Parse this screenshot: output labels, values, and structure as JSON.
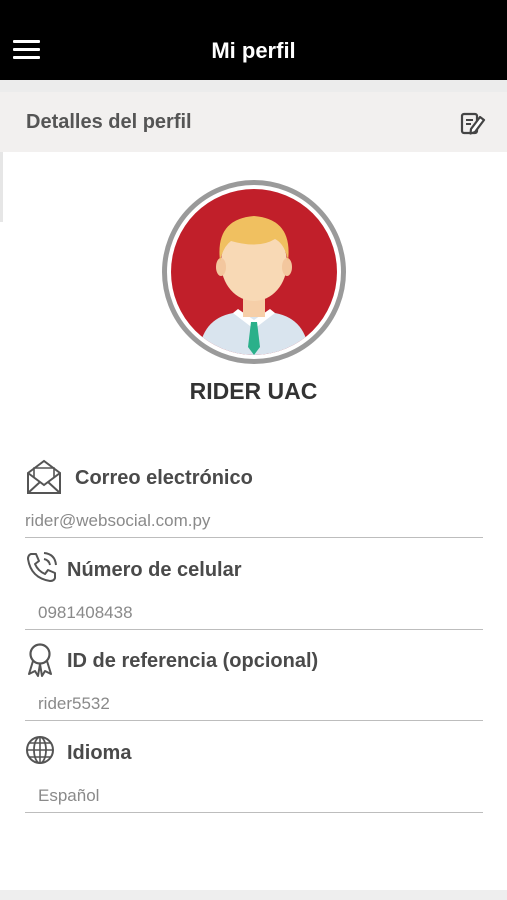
{
  "topbar": {
    "title": "Mi perfil",
    "menu_icon": "hamburger-menu-icon"
  },
  "profile_section": {
    "title": "Detalles del perfil",
    "edit_icon": "edit-icon"
  },
  "user": {
    "name": "RIDER UAC",
    "avatar_icon": "user-avatar-icon",
    "avatar_bg": "#c11f2a"
  },
  "fields": [
    {
      "label": "Correo electrónico",
      "value": "rider@websocial.com.py",
      "icon": "envelope-icon"
    },
    {
      "label": "Número de celular",
      "value": "0981408438",
      "icon": "phone-icon"
    },
    {
      "label": "ID de referencia (opcional)",
      "value": "rider5532",
      "icon": "award-ribbon-icon"
    },
    {
      "label": "Idioma",
      "value": "Español",
      "icon": "globe-icon"
    }
  ]
}
